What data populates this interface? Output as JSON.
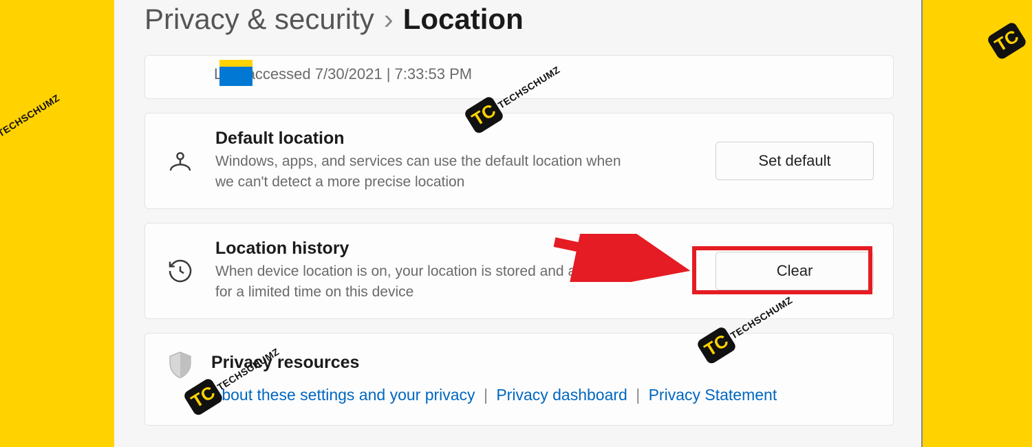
{
  "breadcrumb": {
    "parent": "Privacy & security",
    "separator": "›",
    "current": "Location"
  },
  "lastAccess": {
    "text": "Last accessed 7/30/2021  |  7:33:53 PM"
  },
  "defaultLocation": {
    "title": "Default location",
    "desc": "Windows, apps, and services can use the default location when we can't detect a more precise location",
    "button": "Set default"
  },
  "locationHistory": {
    "title": "Location history",
    "desc": "When device location is on, your location is stored and available for a limited time on this device",
    "button": "Clear"
  },
  "resources": {
    "title": "Privacy resources",
    "links": {
      "about": "About these settings and your privacy",
      "dashboard": "Privacy dashboard",
      "statement": "Privacy Statement"
    }
  },
  "watermark": {
    "tc": "TC",
    "text": "TECHSCHUMZ"
  }
}
